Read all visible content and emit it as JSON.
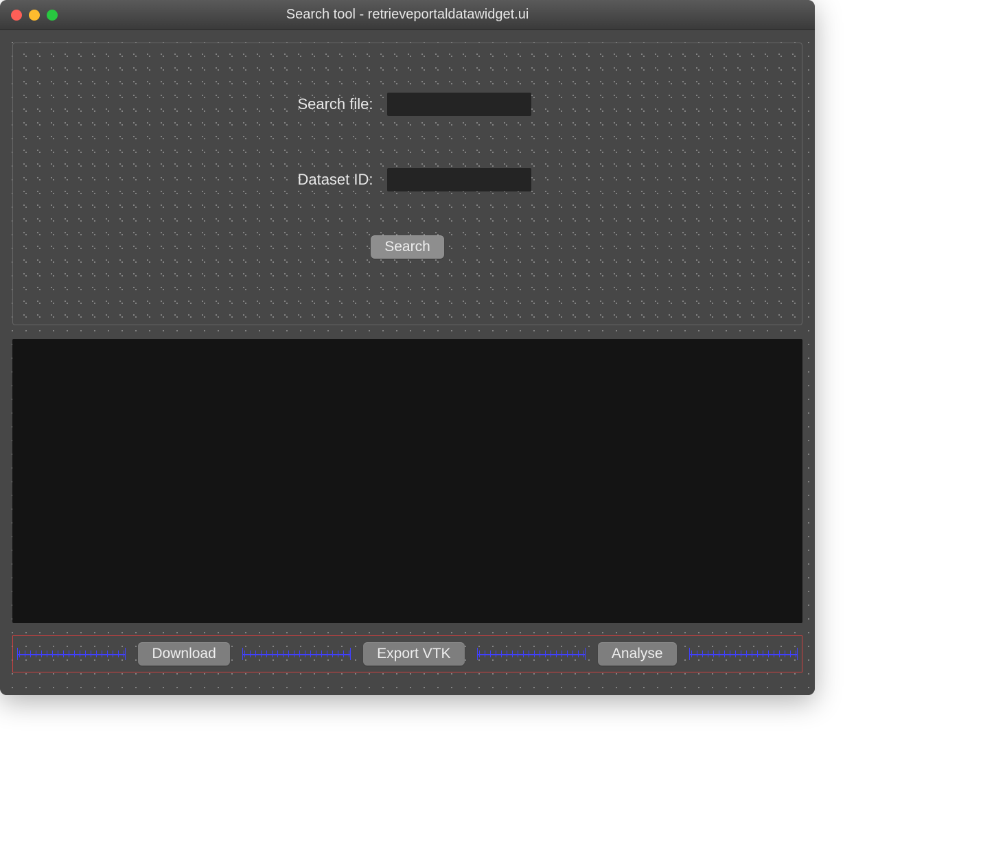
{
  "window": {
    "title": "Search tool - retrieveportaldatawidget.ui"
  },
  "form": {
    "search_file_label": "Search file:",
    "search_file_value": "",
    "dataset_id_label": "Dataset ID:",
    "dataset_id_value": "",
    "search_button_label": "Search"
  },
  "buttons": {
    "download": "Download",
    "export_vtk": "Export VTK",
    "analyse": "Analyse"
  }
}
